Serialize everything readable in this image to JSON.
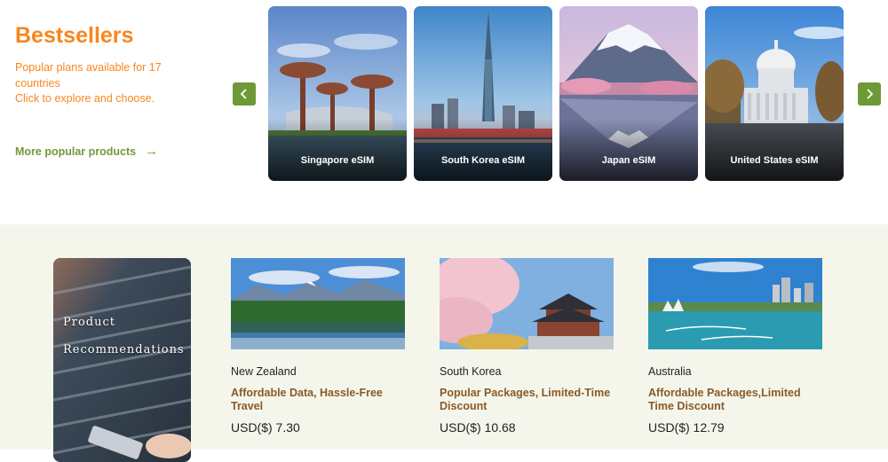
{
  "bestsellers": {
    "title": "Bestsellers",
    "desc_line1": "Popular plans available for 17 countries",
    "desc_line2": "Click to explore and choose.",
    "more_link": "More popular products",
    "cards": [
      {
        "label": "Singapore eSIM"
      },
      {
        "label": "South Korea eSIM"
      },
      {
        "label": "Japan eSIM"
      },
      {
        "label": "United States eSIM"
      }
    ]
  },
  "recommendations": {
    "banner_line1": "Product",
    "banner_line2": "Recommendations",
    "products": [
      {
        "name": "New Zealand",
        "tagline": "Affordable Data, Hassle-Free Travel",
        "price": "USD($) 7.30"
      },
      {
        "name": "South Korea",
        "tagline": "Popular Packages, Limited-Time Discount",
        "price": "USD($) 10.68"
      },
      {
        "name": "Australia",
        "tagline": "Affordable Packages,Limited Time Discount",
        "price": "USD($) 12.79"
      }
    ]
  },
  "colors": {
    "accent_orange": "#f7861f",
    "accent_green": "#74993a",
    "nav_button": "#6d9a36",
    "tagline_brown": "#8a5a26",
    "section_bg": "#f4f6ec"
  },
  "icons": {
    "prev": "chevron-left-icon",
    "next": "chevron-right-icon",
    "more_link_arrow": "arrow-right-icon"
  }
}
